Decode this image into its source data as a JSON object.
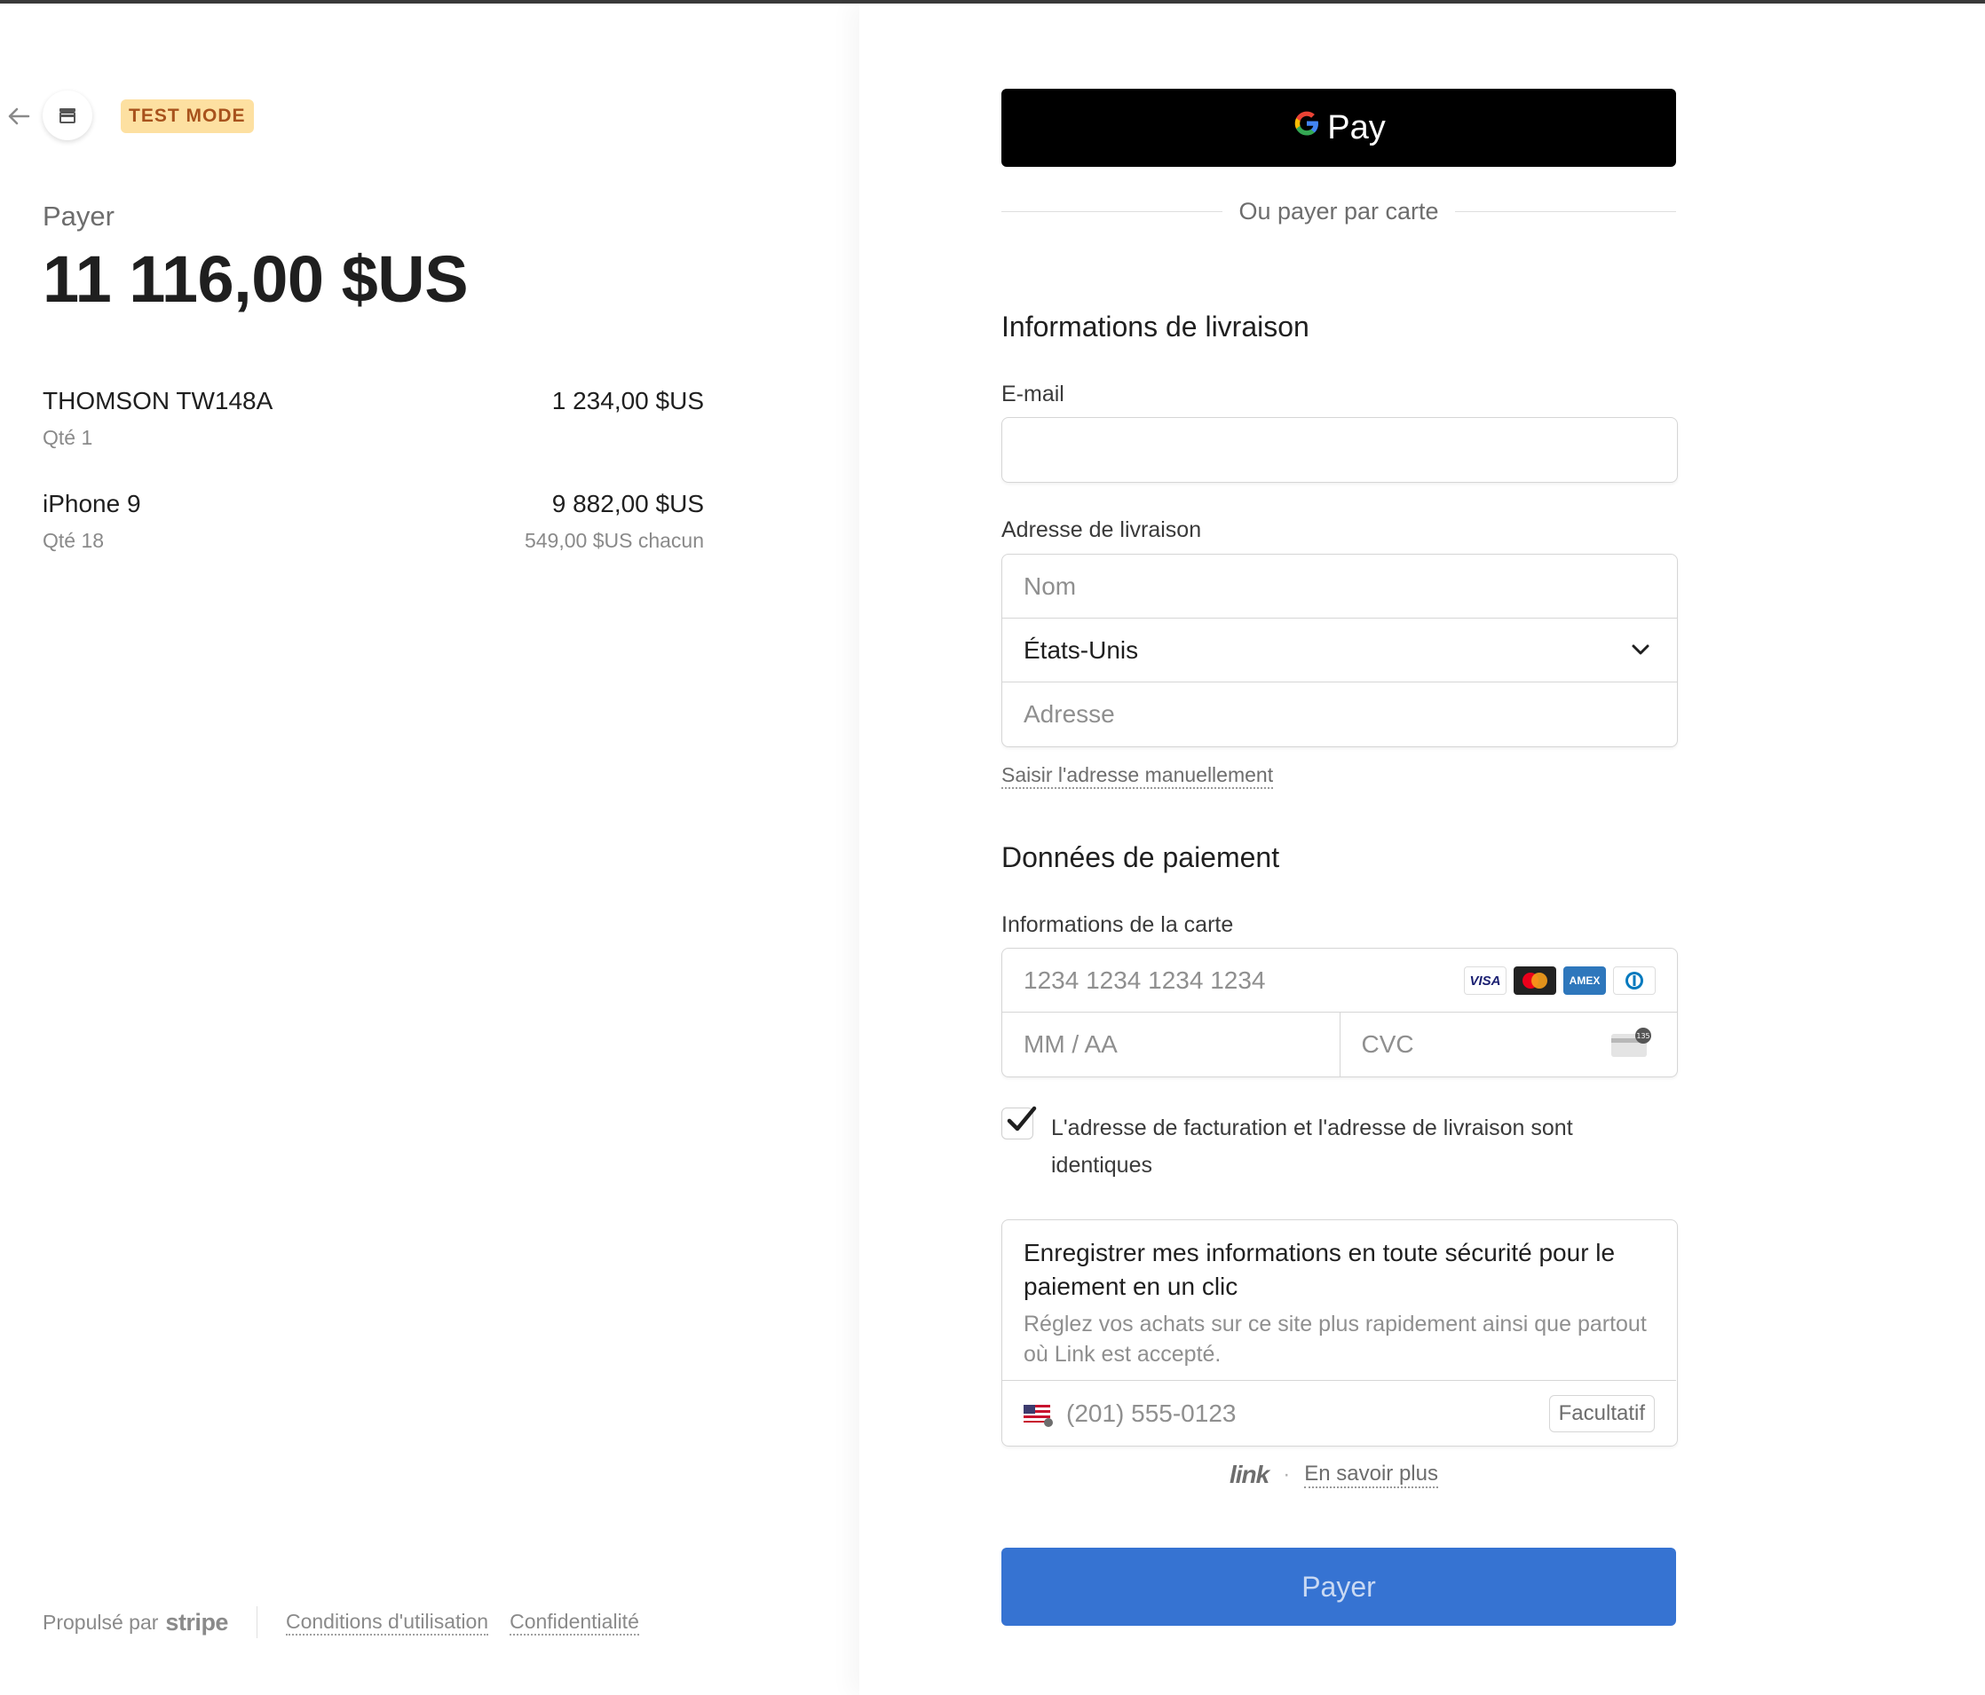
{
  "header": {
    "test_mode_label": "TEST MODE"
  },
  "summary": {
    "pay_label": "Payer",
    "total": "11 116,00 $US",
    "items": [
      {
        "name": "THOMSON TW148A",
        "price": "1 234,00 $US",
        "qty": "Qté 1",
        "unit_price": ""
      },
      {
        "name": "iPhone 9",
        "price": "9 882,00 $US",
        "qty": "Qté 18",
        "unit_price": "549,00 $US chacun"
      }
    ]
  },
  "footer": {
    "powered_by": "Propulsé par",
    "stripe": "stripe",
    "terms": "Conditions d'utilisation",
    "privacy": "Confidentialité"
  },
  "checkout": {
    "gpay_label": "Pay",
    "gpay_g": "G",
    "or_pay_by_card": "Ou payer par carte",
    "shipping_title": "Informations de livraison",
    "email_label": "E-mail",
    "email_value": "",
    "address_label": "Adresse de livraison",
    "name_placeholder": "Nom",
    "country_value": "États-Unis",
    "address_placeholder": "Adresse",
    "manual_address_link": "Saisir l'adresse manuellement",
    "payment_title": "Données de paiement",
    "card_info_label": "Informations de la carte",
    "card_number_placeholder": "1234 1234 1234 1234",
    "expiry_placeholder": "MM / AA",
    "cvc_placeholder": "CVC",
    "card_brands": [
      "VISA",
      "Mastercard",
      "AMEX",
      "Diners"
    ],
    "same_address_label": "L'adresse de facturation et l'adresse de livraison sont identiques",
    "same_address_checked": true,
    "link_title": "Enregistrer mes informations en toute sécurité pour le paiement en un clic",
    "link_desc": "Réglez vos achats sur ce site plus rapidement ainsi que partout où Link est accepté.",
    "phone_placeholder": "(201) 555-0123",
    "optional_label": "Facultatif",
    "link_logo": "link",
    "learn_more": "En savoir plus",
    "pay_button": "Payer"
  },
  "colors": {
    "accent": "#3673d2",
    "badge_bg": "#fde0a1",
    "badge_text": "#a8521c"
  }
}
